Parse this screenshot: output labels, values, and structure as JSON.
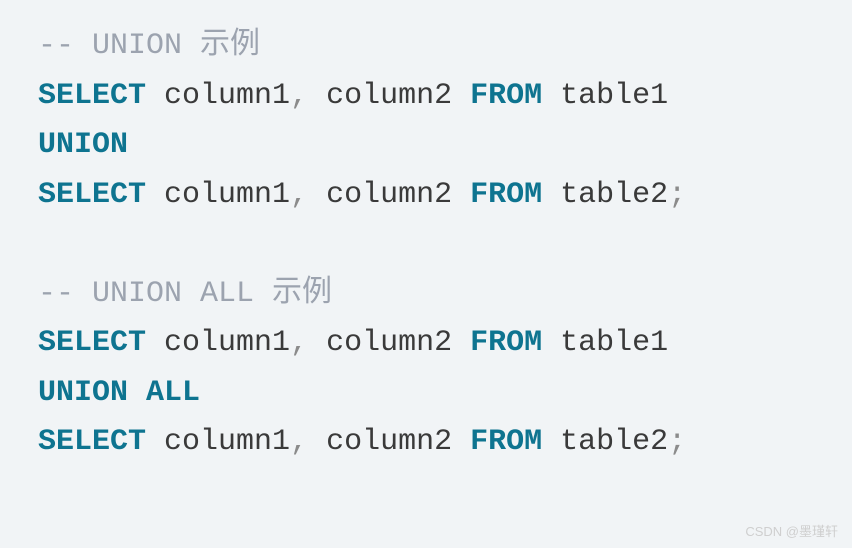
{
  "lines": {
    "l1_comment_prefix": "-- ",
    "l1_comment_text": "UNION 示例",
    "l2_select": "SELECT",
    "l2_cols": " column1",
    "l2_comma": ",",
    "l2_cols2": " column2 ",
    "l2_from": "FROM",
    "l2_table": " table1",
    "l3_union": "UNION",
    "l4_select": "SELECT",
    "l4_cols": " column1",
    "l4_comma": ",",
    "l4_cols2": " column2 ",
    "l4_from": "FROM",
    "l4_table": " table2",
    "l4_semi": ";",
    "l6_comment_prefix": "-- ",
    "l6_comment_text": "UNION ALL 示例",
    "l7_select": "SELECT",
    "l7_cols": " column1",
    "l7_comma": ",",
    "l7_cols2": " column2 ",
    "l7_from": "FROM",
    "l7_table": " table1",
    "l8_union_all": "UNION ALL",
    "l9_select": "SELECT",
    "l9_cols": " column1",
    "l9_comma": ",",
    "l9_cols2": " column2 ",
    "l9_from": "FROM",
    "l9_table": " table2",
    "l9_semi": ";"
  },
  "watermark": "CSDN @墨瑾轩"
}
